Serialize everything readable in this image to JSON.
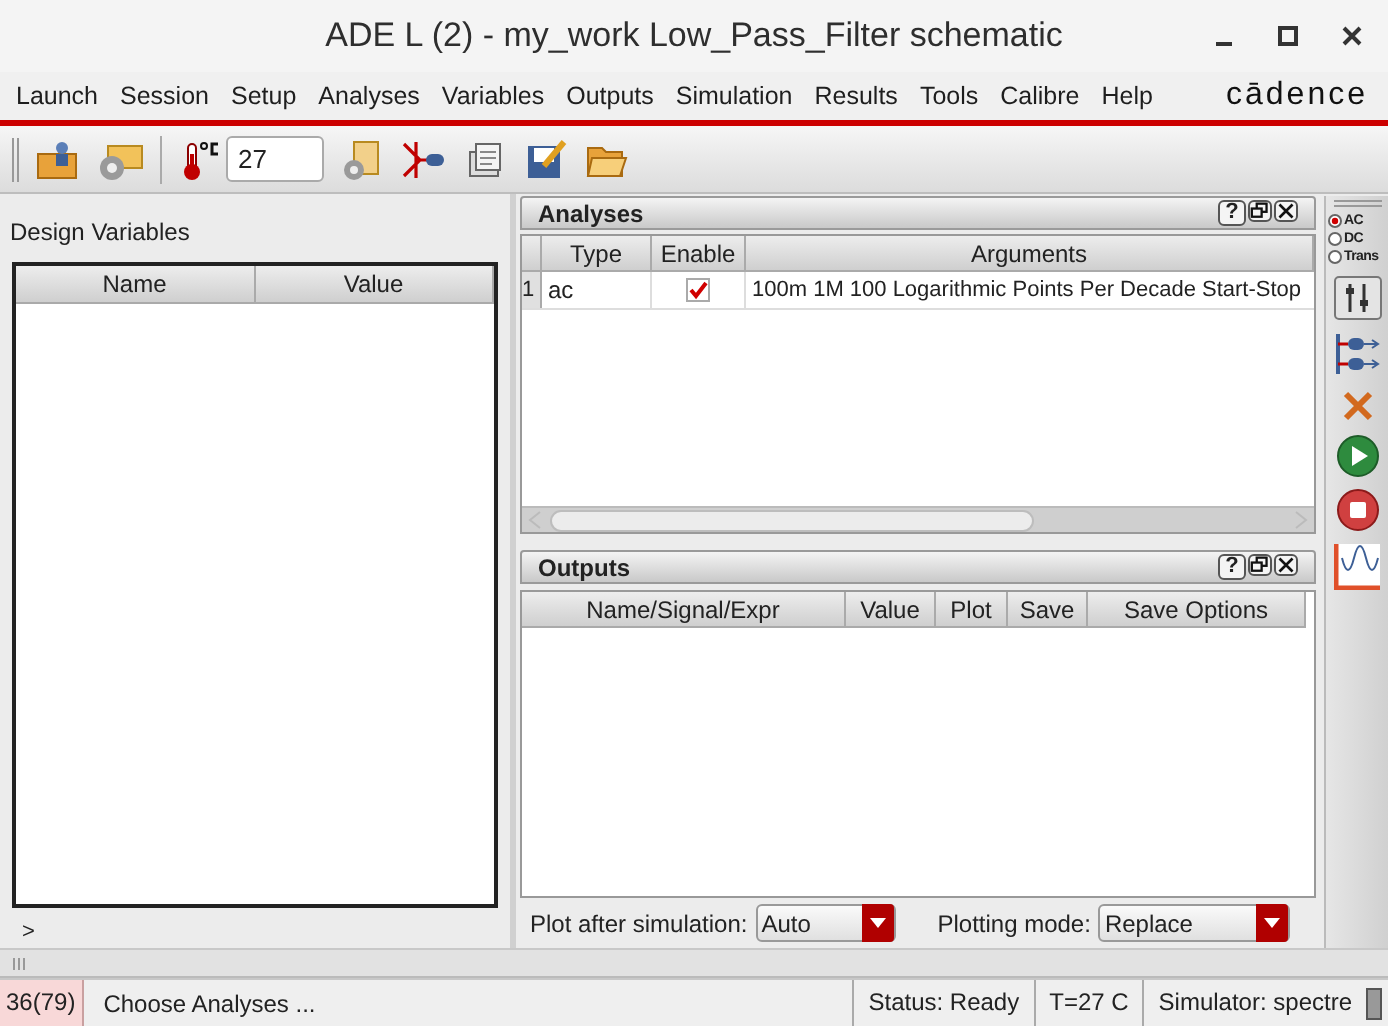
{
  "window": {
    "title": "ADE L (2) - my_work Low_Pass_Filter schematic"
  },
  "menu": [
    "Launch",
    "Session",
    "Setup",
    "Analyses",
    "Variables",
    "Outputs",
    "Simulation",
    "Results",
    "Tools",
    "Calibre",
    "Help"
  ],
  "brand": "cādence",
  "toolbar": {
    "temperature": "27"
  },
  "design_variables": {
    "label": "Design Variables",
    "columns": [
      "Name",
      "Value"
    ],
    "expander": ">"
  },
  "analyses": {
    "title": "Analyses",
    "help_button": "?",
    "columns": [
      "Type",
      "Enable",
      "Arguments"
    ],
    "rows": [
      {
        "index": "1",
        "type": "ac",
        "enabled": true,
        "arguments": "100m 1M 100 Logarithmic Points Per Decade Start-Stop"
      }
    ]
  },
  "outputs": {
    "title": "Outputs",
    "help_button": "?",
    "columns": [
      "Name/Signal/Expr",
      "Value",
      "Plot",
      "Save",
      "Save Options"
    ]
  },
  "plot_options": [
    {
      "label": "Plot after simulation:",
      "value": "Auto"
    },
    {
      "label": "Plotting mode:",
      "value": "Replace"
    }
  ],
  "analysis_types": [
    {
      "label": "AC",
      "selected": true
    },
    {
      "label": "DC",
      "selected": false
    },
    {
      "label": "Trans",
      "selected": false
    }
  ],
  "status_bar": {
    "counter": "36(79)",
    "message": "Choose Analyses ...",
    "status": "Status: Ready",
    "temperature": "T=27 C",
    "simulator": "Simulator: spectre"
  }
}
